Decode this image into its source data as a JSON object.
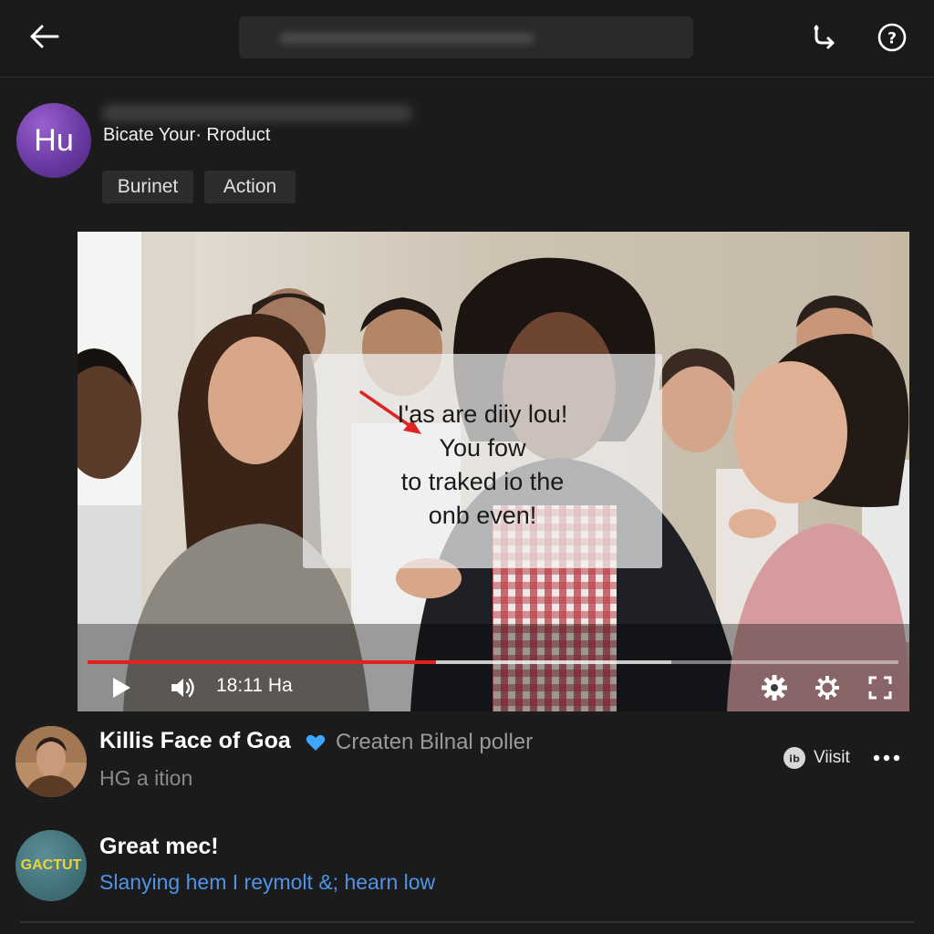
{
  "header": {
    "back_icon": "arrow-left-icon",
    "share_icon": "share-icon",
    "help_icon": "help-circle-icon"
  },
  "channel": {
    "avatar_text": "Hu",
    "avatar_color": "#7a44b8",
    "subtitle": "Bicate Your· Rroduct",
    "chips": [
      "Burinet",
      "Action"
    ]
  },
  "video": {
    "caption_lines": [
      "I'as are diiy lou!",
      "You fow",
      "to traked io the",
      "onb even!"
    ],
    "time": "18:11 Ha",
    "progress": 0.43,
    "buffered": 0.72,
    "progress_color": "#e5201f",
    "controls": [
      "play-icon",
      "volume-icon",
      "settings-icon",
      "gear-icon",
      "fullscreen-icon"
    ]
  },
  "post": {
    "title": "Killis Face of Goa",
    "channel": "Createn Bilnal poller",
    "subtitle": "HG a ition",
    "visit_label": "Viisit",
    "verified_color": "#3ea6ff"
  },
  "comment": {
    "avatar_text": "GACTUT",
    "author": "Great mec!",
    "text": "Slanying hem I reymolt &; hearn low",
    "text_color": "#4f94e8"
  }
}
